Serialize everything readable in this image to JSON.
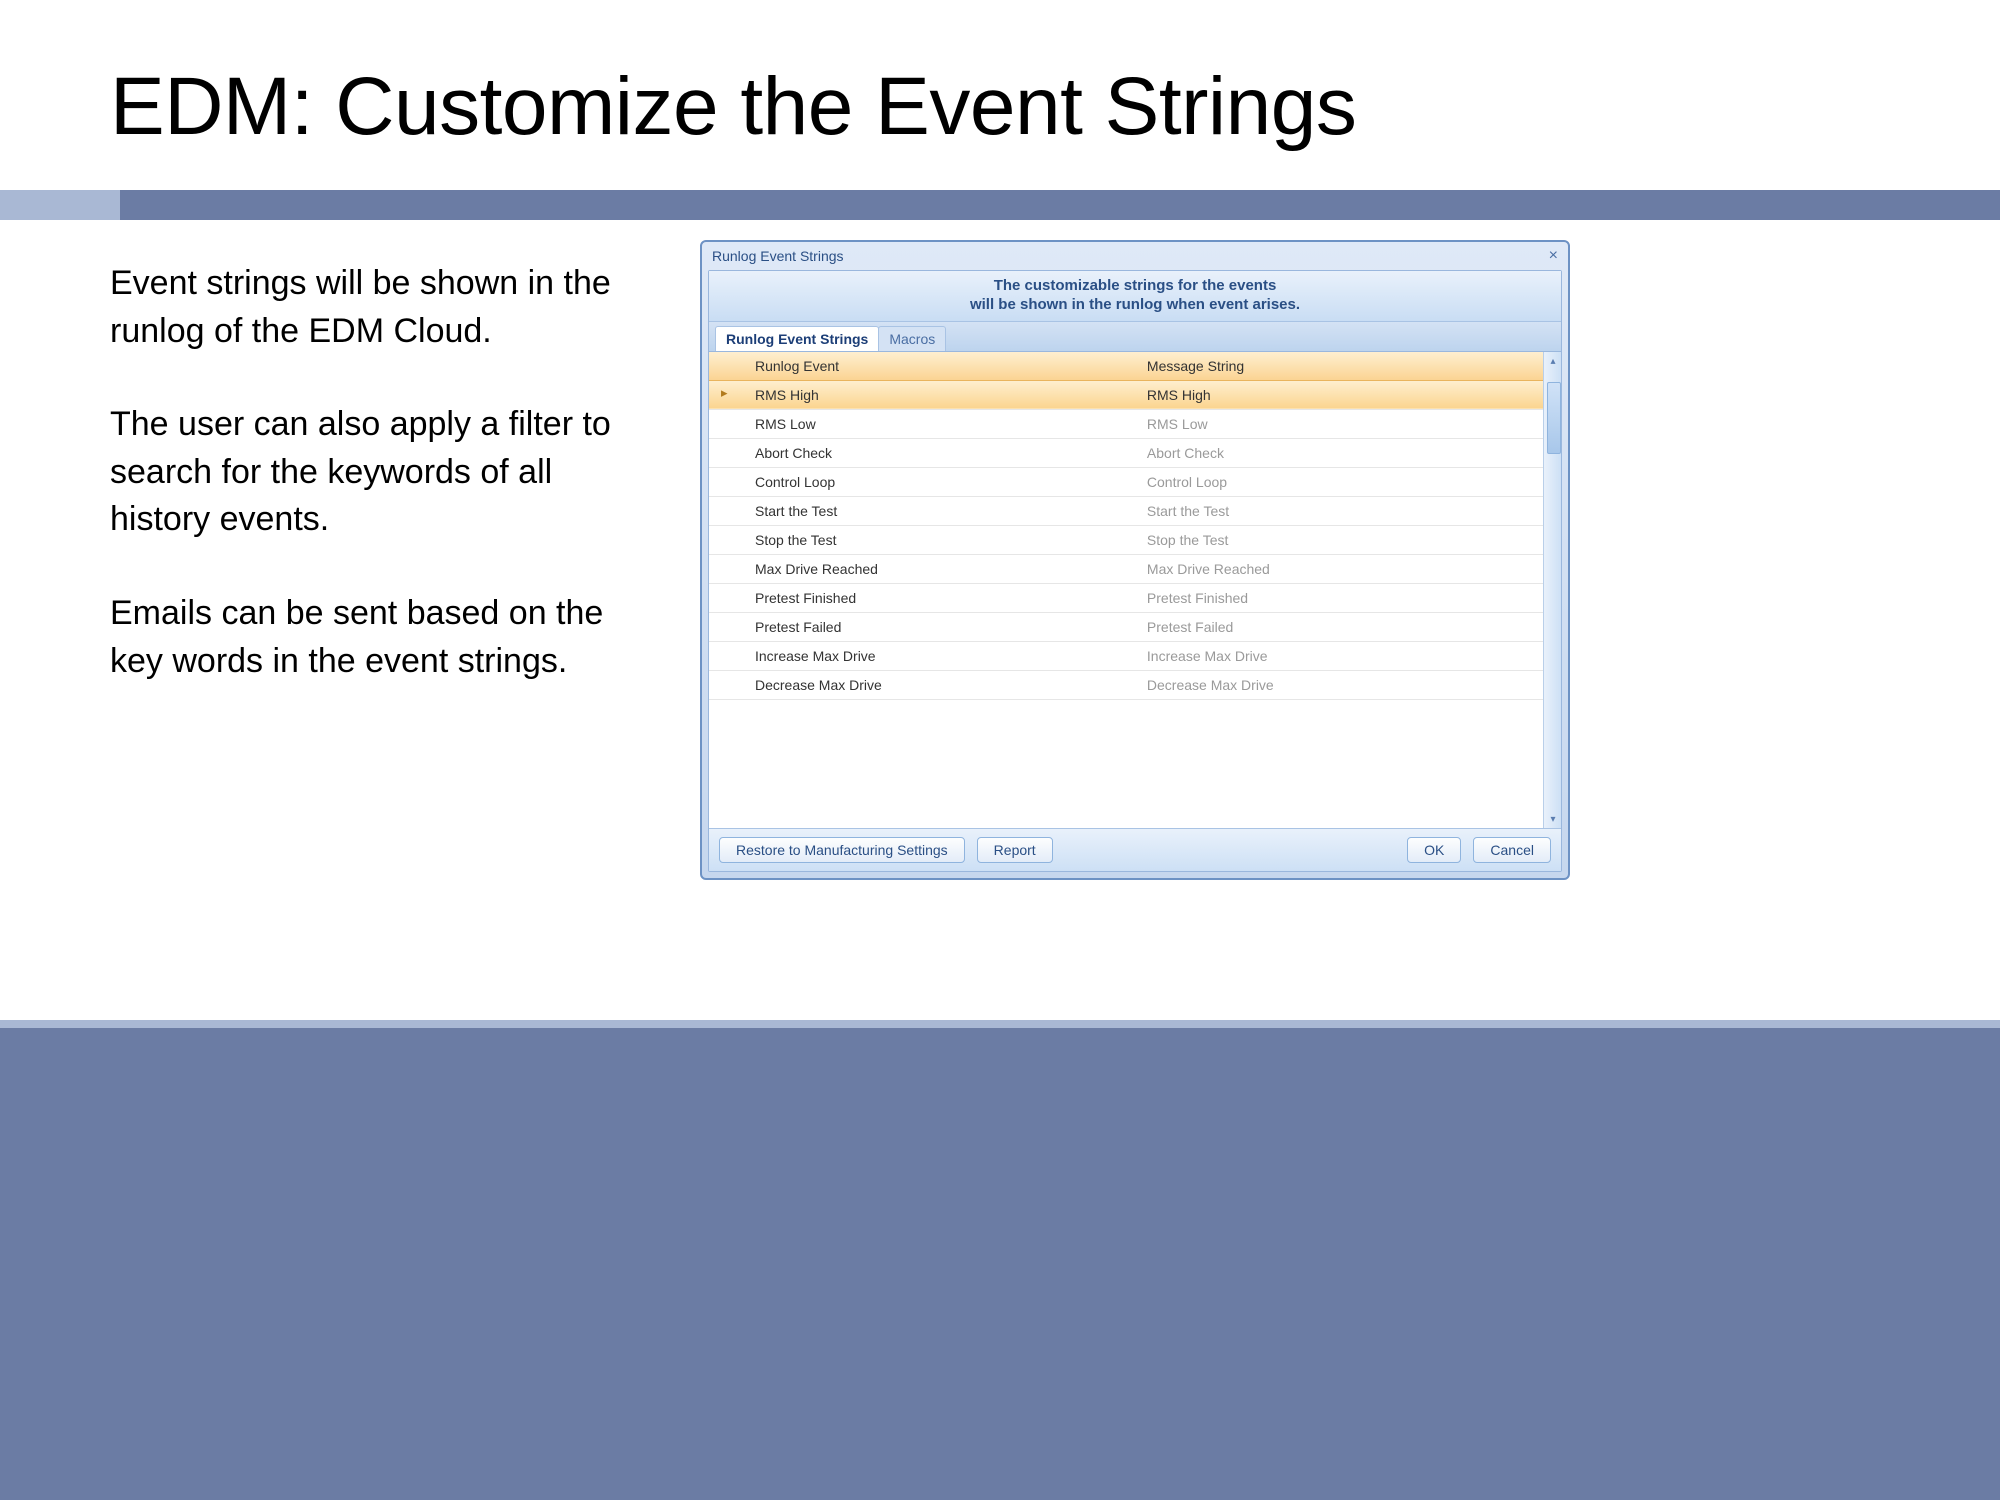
{
  "slide": {
    "title": "EDM: Customize the Event Strings",
    "paragraphs": [
      "Event strings will be shown in the runlog of the EDM Cloud.",
      "The user can also apply a filter to search for the keywords of all history events.",
      "Emails can be sent based on the key words in the event strings."
    ]
  },
  "dialog": {
    "title": "Runlog Event Strings",
    "banner_line1": "The customizable strings for the events",
    "banner_line2": "will be shown in the runlog when event arises.",
    "tabs": {
      "active": "Runlog Event Strings",
      "inactive": "Macros"
    },
    "columns": {
      "event": "Runlog Event",
      "message": "Message String"
    },
    "rows": [
      {
        "event": "RMS High",
        "message": "RMS High",
        "selected": true
      },
      {
        "event": "RMS Low",
        "message": "RMS Low",
        "selected": false
      },
      {
        "event": "Abort Check",
        "message": "Abort Check",
        "selected": false
      },
      {
        "event": "Control Loop",
        "message": "Control Loop",
        "selected": false
      },
      {
        "event": "Start the Test",
        "message": "Start the Test",
        "selected": false
      },
      {
        "event": "Stop the Test",
        "message": "Stop the Test",
        "selected": false
      },
      {
        "event": "Max Drive Reached",
        "message": "Max Drive Reached",
        "selected": false
      },
      {
        "event": "Pretest Finished",
        "message": "Pretest Finished",
        "selected": false
      },
      {
        "event": "Pretest Failed",
        "message": "Pretest Failed",
        "selected": false
      },
      {
        "event": "Increase Max Drive",
        "message": "Increase Max Drive",
        "selected": false
      },
      {
        "event": "Decrease Max Drive",
        "message": "Decrease Max Drive",
        "selected": false
      }
    ],
    "buttons": {
      "restore": "Restore to Manufacturing Settings",
      "report": "Report",
      "ok": "OK",
      "cancel": "Cancel"
    }
  }
}
